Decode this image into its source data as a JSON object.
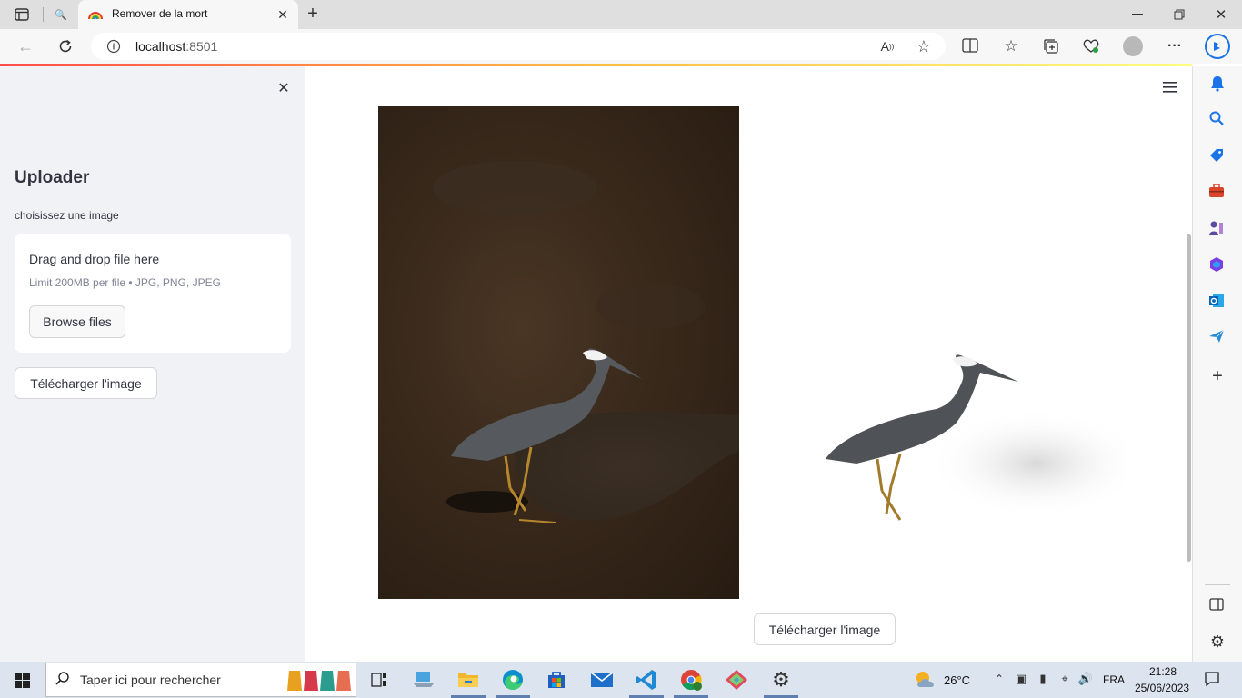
{
  "browser": {
    "tab_title": "Remover de la mort",
    "url_host": "localhost",
    "url_port": ":8501"
  },
  "sidebar": {
    "title": "Uploader",
    "upload_label": "choisissez une image",
    "dropzone_text": "Drag and drop file here",
    "dropzone_limit": "Limit 200MB per file • JPG, PNG, JPEG",
    "browse_label": "Browse files",
    "download_label": "Télécharger l'image"
  },
  "main": {
    "download_label": "Télécharger l'image"
  },
  "taskbar": {
    "search_placeholder": "Taper ici pour rechercher",
    "weather_temp": "26°C",
    "language": "FRA",
    "time": "21:28",
    "date": "25/06/2023"
  },
  "colors": {
    "accent": "#ff4b4b",
    "sidebar_bg": "#f0f2f6"
  }
}
